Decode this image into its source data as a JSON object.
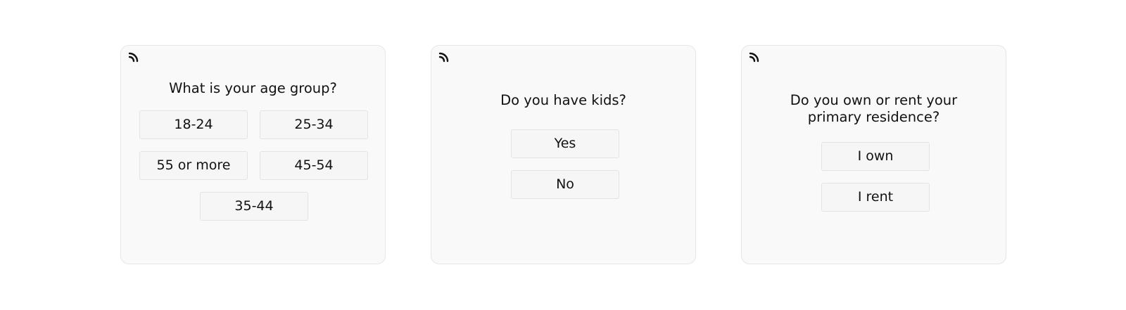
{
  "cards": [
    {
      "icon": "rss-feed-icon",
      "question_lines": [
        "What is your age group?"
      ],
      "options": [
        "18-24",
        "25-34",
        "55 or more",
        "45-54",
        "35-44"
      ]
    },
    {
      "icon": "rss-feed-icon",
      "question_lines": [
        "Do you have kids?"
      ],
      "options": [
        "Yes",
        "No"
      ]
    },
    {
      "icon": "rss-feed-icon",
      "question_lines": [
        "Do you own or rent your",
        "primary residence?"
      ],
      "options": [
        "I own",
        "I rent"
      ]
    }
  ],
  "colors": {
    "card_bg": "#f9f9f9",
    "card_border": "#e6e6e6",
    "button_bg": "#f6f6f6",
    "button_border": "#e3e3e3",
    "text": "#111111"
  }
}
